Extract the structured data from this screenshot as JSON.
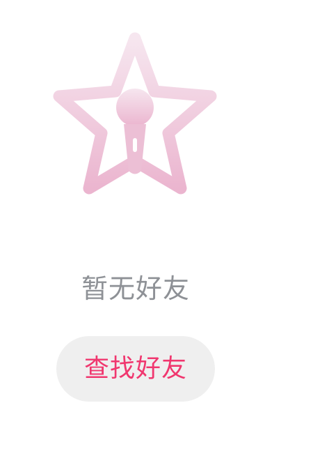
{
  "empty_state": {
    "message": "暂无好友",
    "icon": "star-microphone-icon",
    "illustration_colors": {
      "top": "#f5e3ed",
      "bottom": "#ecb7d0"
    }
  },
  "actions": {
    "find_friends_label": "查找好友"
  },
  "colors": {
    "message_text": "#8e9196",
    "button_text": "#f0376f",
    "button_background": "#efefef"
  }
}
